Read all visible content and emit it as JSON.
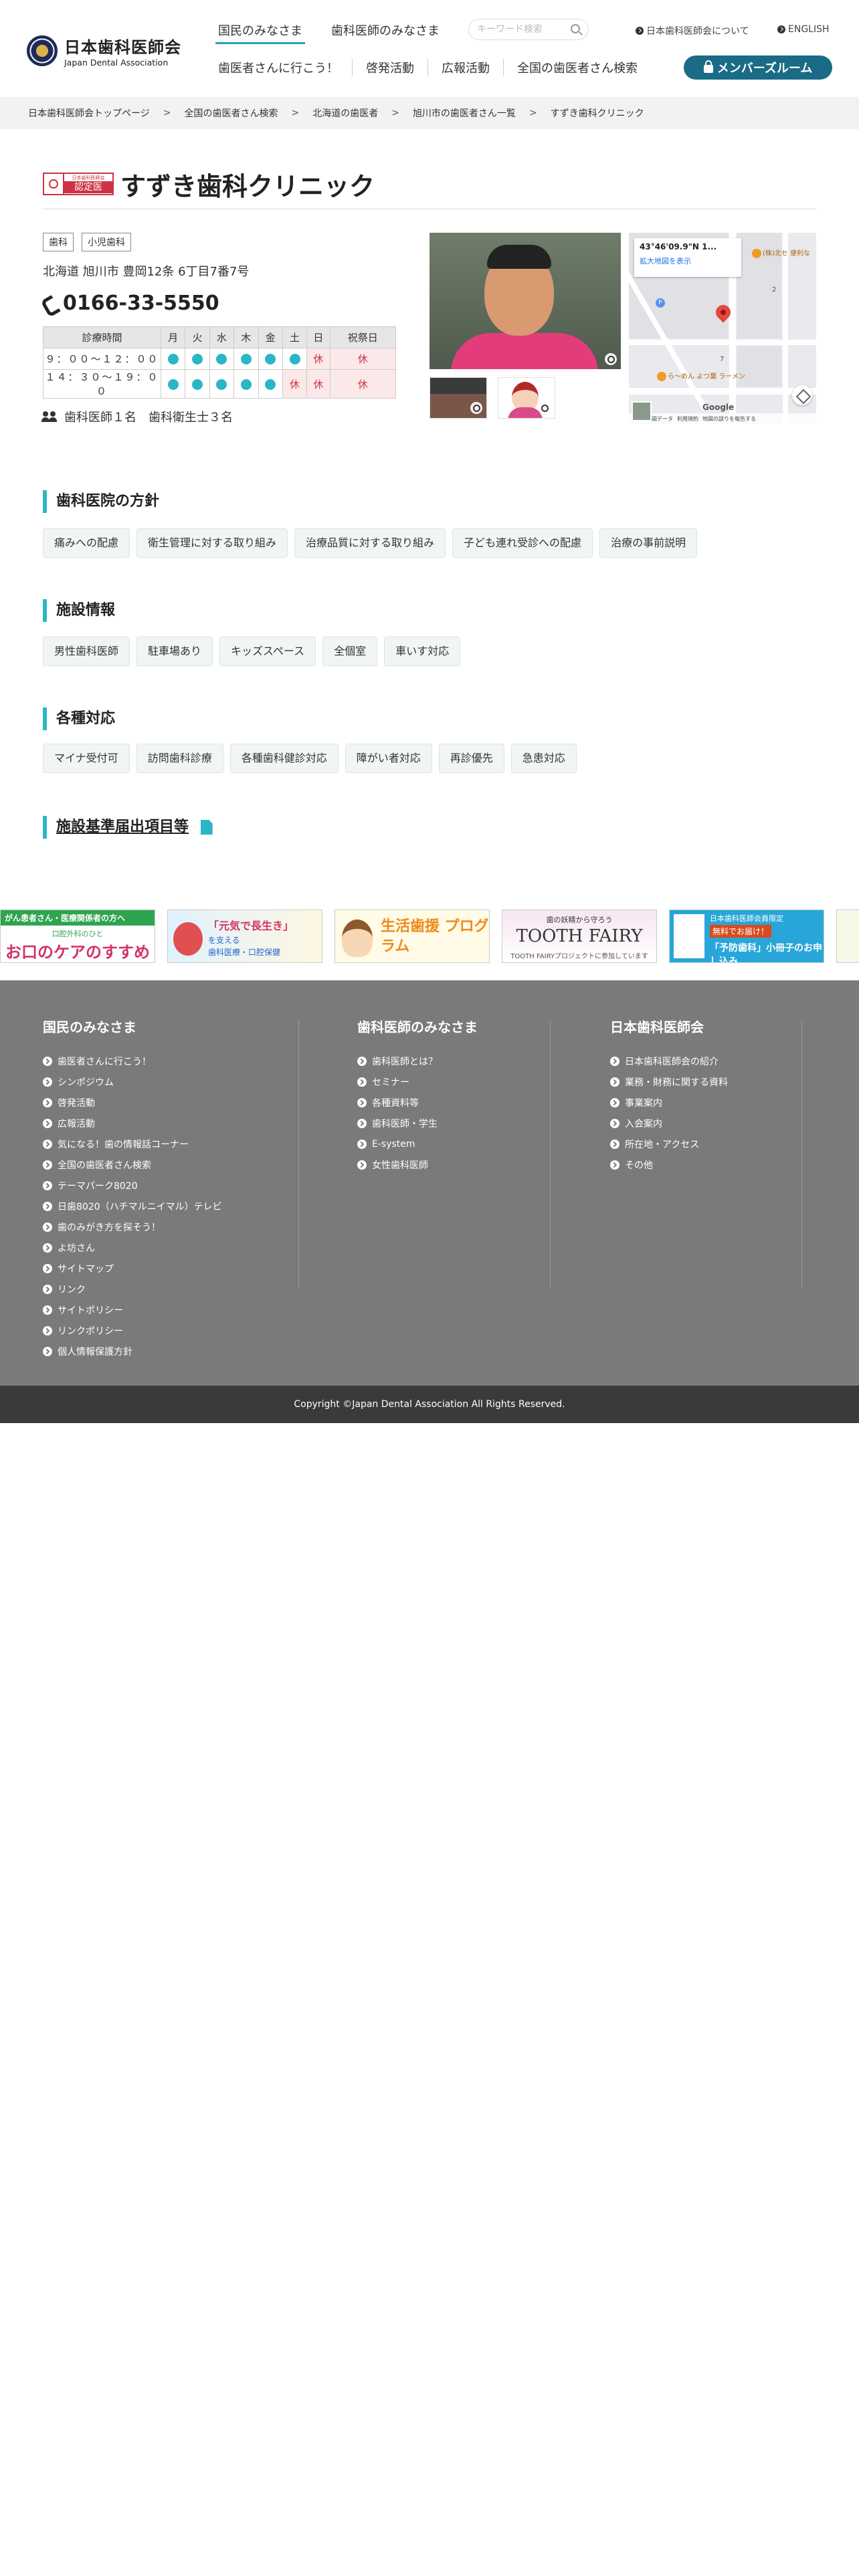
{
  "header": {
    "logo_jp": "日本歯科医師会",
    "logo_en": "Japan Dental Association",
    "tab_public": "国民のみなさま",
    "tab_dentists": "歯科医師のみなさま",
    "search_placeholder": "キーワード検索",
    "link_about": "日本歯科医師会について",
    "link_english": "ENGLISH",
    "subnav": [
      "歯医者さんに行こう！",
      "啓発活動",
      "広報活動",
      "全国の歯医者さん検索"
    ],
    "member_button": "メンバーズルーム"
  },
  "breadcrumb": [
    "日本歯科医師会トップページ",
    "全国の歯医者さん検索",
    "北海道の歯医者",
    "旭川市の歯医者さん一覧",
    "すずき歯科クリニック"
  ],
  "breadcrumb_separator": ">",
  "clinic": {
    "badge_small": "日本歯科医師会",
    "badge_main": "認定医",
    "name": "すずき歯科クリニック",
    "tags": [
      "歯科",
      "小児歯科"
    ],
    "address": "北海道 旭川市 豊岡12条 6丁目7番7号",
    "phone": "0166-33-5550",
    "hours": {
      "header": [
        "診療時間",
        "月",
        "火",
        "水",
        "木",
        "金",
        "土",
        "日",
        "祝祭日"
      ],
      "rows": [
        {
          "time": "９：００〜１２：００",
          "days": [
            "open",
            "open",
            "open",
            "open",
            "open",
            "open",
            "休",
            "休"
          ]
        },
        {
          "time": "１４：３０〜１９：００",
          "days": [
            "open",
            "open",
            "open",
            "open",
            "open",
            "休",
            "休",
            "休"
          ]
        }
      ]
    },
    "staff": "歯科医師１名　歯科衛生士３名"
  },
  "map": {
    "coords": "43°46'09.9\"N 1...",
    "enlarge": "拡大地図を表示",
    "poi_label_1": "(株)北セ 便利な",
    "poi_label_2": "ら～めん よつ葉 ラーメン",
    "num_1": "2",
    "num_2": "7",
    "google": "Google",
    "attrib": [
      "地図データ",
      "利用規約",
      "地図の誤りを報告する"
    ]
  },
  "sections": {
    "policy": {
      "title": "歯科医院の方針",
      "items": [
        "痛みへの配慮",
        "衛生管理に対する取り組み",
        "治療品質に対する取り組み",
        "子ども連れ受診への配慮",
        "治療の事前説明"
      ]
    },
    "facility": {
      "title": "施設情報",
      "items": [
        "男性歯科医師",
        "駐車場あり",
        "キッズスペース",
        "全個室",
        "車いす対応"
      ]
    },
    "support": {
      "title": "各種対応",
      "items": [
        "マイナ受付可",
        "訪問歯科診療",
        "各種歯科健診対応",
        "障がい者対応",
        "再診優先",
        "急患対応"
      ]
    },
    "standards": {
      "title": "施設基準届出項目等"
    }
  },
  "banners": {
    "b1_top": "がん患者さん・医療関係者の方へ",
    "b1_sub": "口腔外科のひと",
    "b1_main": "お口のケアのすすめ",
    "b2_main": "「元気で長生き」",
    "b2_sub": "を支える",
    "b2_sub2": "歯科医療・口腔保健",
    "b3_main": "生活歯援 プログラム",
    "b4_sub": "歯の妖精から守ろう",
    "b4_main": "TOOTH FAIRY",
    "b4_foot": "TOOTH FAIRYプロジェクトに参加しています",
    "b5_sub": "日本歯科医師会員限定",
    "b5_tag": "無料でお届け！",
    "b5_main": "「予防歯科」小冊子のお申し込み"
  },
  "footer": {
    "col1_title": "国民のみなさま",
    "col1_items": [
      "歯医者さんに行こう！",
      "シンポジウム",
      "啓発活動",
      "広報活動",
      "気になる！歯の情報話コーナー",
      "全国の歯医者さん検索",
      "テーマパーク8020",
      "日歯8020（ハチマルニイマル）テレビ",
      "歯のみがき方を探そう！",
      "よ坊さん",
      "サイトマップ",
      "リンク",
      "サイトポリシー",
      "リンクポリシー",
      "個人情報保護方針"
    ],
    "col2_title": "歯科医師のみなさま",
    "col2_items": [
      "歯科医師とは？",
      "セミナー",
      "各種資料等",
      "歯科医師・学生",
      "E-system",
      "女性歯科医師"
    ],
    "col3_title": "日本歯科医師会",
    "col3_items": [
      "日本歯科医師会の紹介",
      "業務・財務に関する資料",
      "事業案内",
      "入会案内",
      "所在地・アクセス",
      "その他"
    ],
    "copyright": "Copyright ©Japan Dental Association All Rights Reserved."
  }
}
